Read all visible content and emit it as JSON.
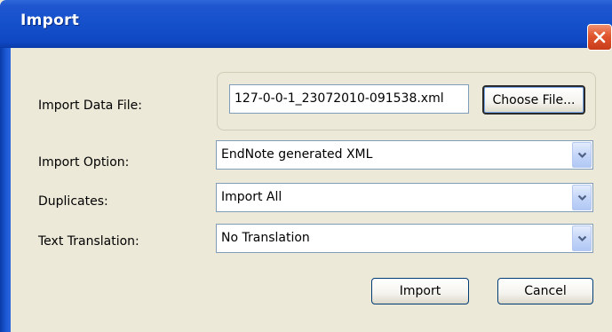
{
  "window": {
    "title": "Import"
  },
  "icons": {
    "close": "close-x-icon",
    "dropdown": "chevron-down-icon"
  },
  "form": {
    "import_data_file": {
      "label": "Import Data File:",
      "value": "127-0-0-1_23072010-091538.xml",
      "choose_label": "Choose File..."
    },
    "import_option": {
      "label": "Import Option:",
      "value": "EndNote generated XML"
    },
    "duplicates": {
      "label": "Duplicates:",
      "value": "Import All"
    },
    "text_translation": {
      "label": "Text Translation:",
      "value": "No Translation"
    }
  },
  "buttons": {
    "import": "Import",
    "cancel": "Cancel"
  },
  "colors": {
    "titlebar": "#1550cb",
    "close": "#e0552e",
    "face": "#ece9d8",
    "field_border": "#7f9db9"
  }
}
